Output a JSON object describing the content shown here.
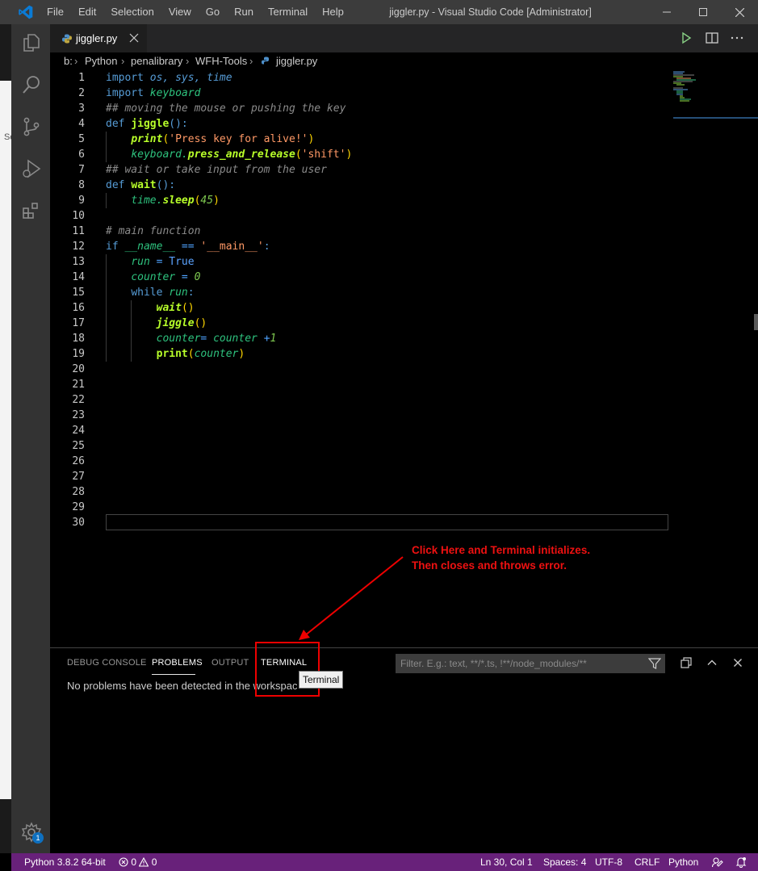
{
  "titlebar": {
    "menu": [
      "File",
      "Edit",
      "Selection",
      "View",
      "Go",
      "Run",
      "Terminal",
      "Help"
    ],
    "title": "jiggler.py - Visual Studio Code [Administrator]"
  },
  "tab": {
    "label": "jiggler.py"
  },
  "breadcrumb": [
    "b:",
    "Python",
    "penalibrary",
    "WFH-Tools",
    "jiggler.py"
  ],
  "code": {
    "line_numbers": [
      "1",
      "2",
      "3",
      "4",
      "5",
      "6",
      "7",
      "8",
      "9",
      "10",
      "11",
      "12",
      "13",
      "14",
      "15",
      "16",
      "17",
      "18",
      "19",
      "20",
      "21",
      "22",
      "23",
      "24",
      "25",
      "26",
      "27",
      "28",
      "29",
      "30"
    ],
    "lines": [
      [
        [
          "kw",
          "import "
        ],
        [
          "mod",
          "os, sys, time"
        ]
      ],
      [
        [
          "kw",
          "import "
        ],
        [
          "var",
          "keyboard"
        ]
      ],
      [
        [
          "cm",
          "## moving the mouse or pushing the key"
        ]
      ],
      [
        [
          "kw",
          "def "
        ],
        [
          "fnp",
          "jiggle"
        ],
        [
          "kw",
          "():"
        ]
      ],
      [
        [
          "",
          "    "
        ],
        [
          "fn",
          "print"
        ],
        [
          "punc",
          "("
        ],
        [
          "str",
          "'Press key for alive!'"
        ],
        [
          "punc",
          ")"
        ]
      ],
      [
        [
          "",
          "    "
        ],
        [
          "var",
          "keyboard."
        ],
        [
          "fn",
          "press_and_release"
        ],
        [
          "punc",
          "("
        ],
        [
          "str",
          "'shift'"
        ],
        [
          "punc",
          ")"
        ]
      ],
      [
        [
          "cm",
          "## wait or take input from the user"
        ]
      ],
      [
        [
          "kw",
          "def "
        ],
        [
          "fnp",
          "wait"
        ],
        [
          "kw",
          "():"
        ]
      ],
      [
        [
          "",
          "    "
        ],
        [
          "var",
          "time."
        ],
        [
          "fn",
          "sleep"
        ],
        [
          "punc",
          "("
        ],
        [
          "num",
          "45"
        ],
        [
          "punc",
          ")"
        ]
      ],
      [],
      [
        [
          "cm",
          "# main function"
        ]
      ],
      [
        [
          "kw",
          "if "
        ],
        [
          "var",
          "__name__"
        ],
        [
          "op",
          " == "
        ],
        [
          "str",
          "'__main__'"
        ],
        [
          "kw",
          ":"
        ]
      ],
      [
        [
          "",
          "    "
        ],
        [
          "var",
          "run"
        ],
        [
          "op",
          " = "
        ],
        [
          "tru",
          "True"
        ]
      ],
      [
        [
          "",
          "    "
        ],
        [
          "var",
          "counter"
        ],
        [
          "op",
          " = "
        ],
        [
          "num",
          "0"
        ]
      ],
      [
        [
          "",
          "    "
        ],
        [
          "kw",
          "while "
        ],
        [
          "var",
          "run"
        ],
        [
          "kw",
          ":"
        ]
      ],
      [
        [
          "",
          "        "
        ],
        [
          "fn",
          "wait"
        ],
        [
          "punc",
          "()"
        ]
      ],
      [
        [
          "",
          "        "
        ],
        [
          "fn",
          "jiggle"
        ],
        [
          "punc",
          "()"
        ]
      ],
      [
        [
          "",
          "        "
        ],
        [
          "var",
          "counter"
        ],
        [
          "op",
          "= "
        ],
        [
          "var",
          "counter "
        ],
        [
          "op",
          "+"
        ],
        [
          "num",
          "1"
        ]
      ],
      [
        [
          "",
          "        "
        ],
        [
          "fnp",
          "print"
        ],
        [
          "punc",
          "("
        ],
        [
          "var",
          "counter"
        ],
        [
          "punc",
          ")"
        ]
      ],
      [],
      [],
      [],
      [],
      [],
      [],
      [],
      [],
      [],
      [],
      []
    ]
  },
  "annotation": {
    "line1": "Click Here and Terminal initializes.",
    "line2": "Then closes and throws error."
  },
  "panel": {
    "tabs": [
      "DEBUG CONSOLE",
      "PROBLEMS",
      "OUTPUT",
      "TERMINAL"
    ],
    "filter_placeholder": "Filter. E.g.: text, **/*.ts, !**/node_modules/**",
    "message": "No problems have been detected in the workspac",
    "tooltip": "Terminal"
  },
  "activity_badge": "1",
  "left_strip_text": "Se",
  "statusbar": {
    "python": "Python 3.8.2 64-bit",
    "errors": "0",
    "warnings": "0",
    "position": "Ln 30, Col 1",
    "spaces": "Spaces: 4",
    "encoding": "UTF-8",
    "eol": "CRLF",
    "language": "Python"
  },
  "colors": {
    "statusbar": "#68217a",
    "annotation": "#ee1111",
    "activitybar": "#333333"
  },
  "icons": [
    "vscode-logo-icon",
    "explorer-icon",
    "search-icon",
    "source-control-icon",
    "run-debug-icon",
    "extensions-icon",
    "gear-icon",
    "python-file-icon",
    "close-icon",
    "run-icon",
    "split-editor-icon",
    "more-icon",
    "filter-icon",
    "collapse-icon",
    "chevron-up-icon",
    "error-icon",
    "warning-icon",
    "feedback-icon",
    "bell-icon"
  ]
}
